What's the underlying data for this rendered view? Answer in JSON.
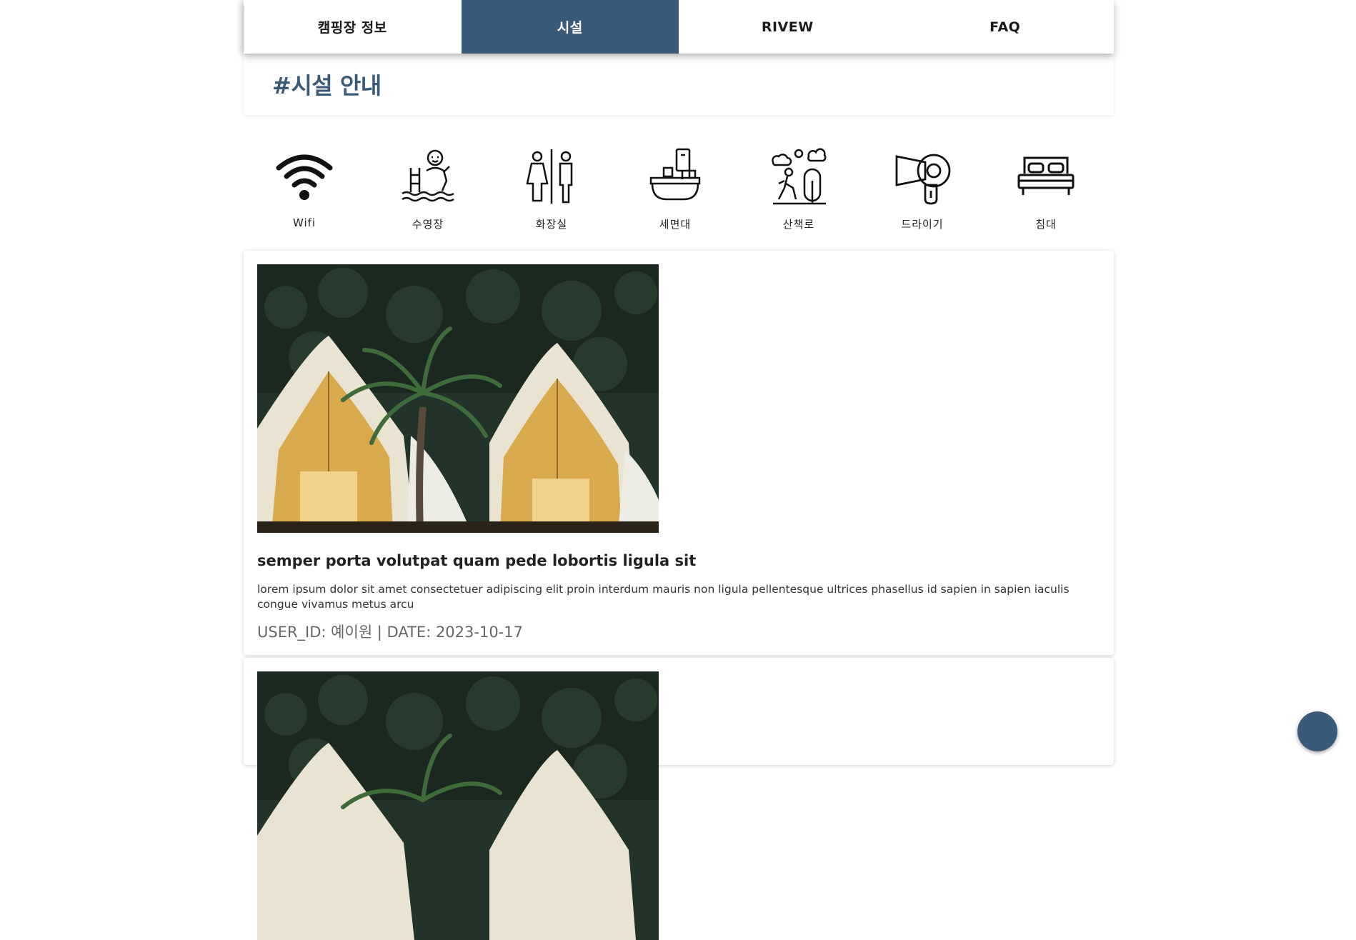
{
  "tabs": [
    {
      "label": "캠핑장 정보",
      "active": false
    },
    {
      "label": "시설",
      "active": true
    },
    {
      "label": "RIVEW",
      "active": false
    },
    {
      "label": "FAQ",
      "active": false
    }
  ],
  "section": {
    "title": "#시설 안내"
  },
  "facilities": [
    {
      "label": "Wifi",
      "icon": "wifi-icon"
    },
    {
      "label": "수영장",
      "icon": "swimming-pool-icon"
    },
    {
      "label": "화장실",
      "icon": "restroom-icon"
    },
    {
      "label": "세면대",
      "icon": "washbasin-icon"
    },
    {
      "label": "산책로",
      "icon": "walking-trail-icon"
    },
    {
      "label": "드라이기",
      "icon": "hair-dryer-icon"
    },
    {
      "label": "침대",
      "icon": "bed-icon"
    }
  ],
  "cards": [
    {
      "title": "semper porta volutpat quam pede lobortis ligula sit",
      "body": "lorem ipsum dolor sit amet consectetuer adipiscing elit proin interdum mauris non ligula pellentesque ultrices phasellus id sapien in sapien iaculis congue vivamus metus arcu",
      "meta": "USER_ID: 예이원 | DATE: 2023-10-17",
      "image": "glamping-tents-photo"
    },
    {
      "title": "",
      "body": "",
      "meta": "",
      "image": "glamping-tents-photo"
    }
  ],
  "colors": {
    "accent": "#3a5a7a"
  }
}
